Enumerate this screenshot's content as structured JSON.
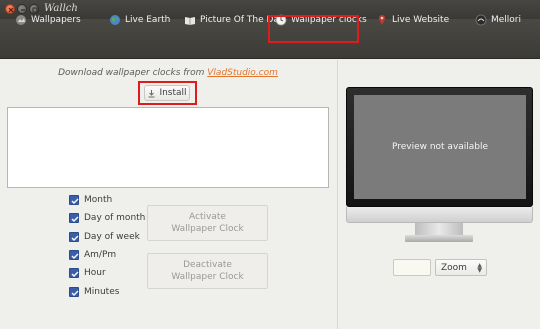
{
  "window": {
    "title": "Wallch"
  },
  "tabs": [
    {
      "label": "Wallpapers",
      "icon": "wallpapers-icon"
    },
    {
      "label": "Live Earth",
      "icon": "earth-icon"
    },
    {
      "label": "Picture Of The Day",
      "icon": "book-icon"
    },
    {
      "label": "Wallpaper clocks",
      "icon": "clock-icon",
      "active": true
    },
    {
      "label": "Live Website",
      "icon": "map-pin-icon"
    },
    {
      "label": "Mellori",
      "icon": "mellori-icon"
    }
  ],
  "clocks": {
    "download_text": "Download wallpaper clocks from ",
    "download_link": "VladStudio.com",
    "install_label": "Install",
    "options": [
      {
        "label": "Month",
        "checked": true
      },
      {
        "label": "Day of month",
        "checked": true
      },
      {
        "label": "Day of week",
        "checked": true
      },
      {
        "label": "Am/Pm",
        "checked": true
      },
      {
        "label": "Hour",
        "checked": true
      },
      {
        "label": "Minutes",
        "checked": true
      }
    ],
    "activate_label_1": "Activate",
    "activate_label_2": "Wallpaper Clock",
    "deactivate_label_1": "Deactivate",
    "deactivate_label_2": "Wallpaper Clock"
  },
  "preview": {
    "message": "Preview not available",
    "zoom_value": "Zoom"
  },
  "colors": {
    "highlight": "#e01b1b",
    "link": "#e2762d",
    "checkbox": "#3a5ea8"
  }
}
